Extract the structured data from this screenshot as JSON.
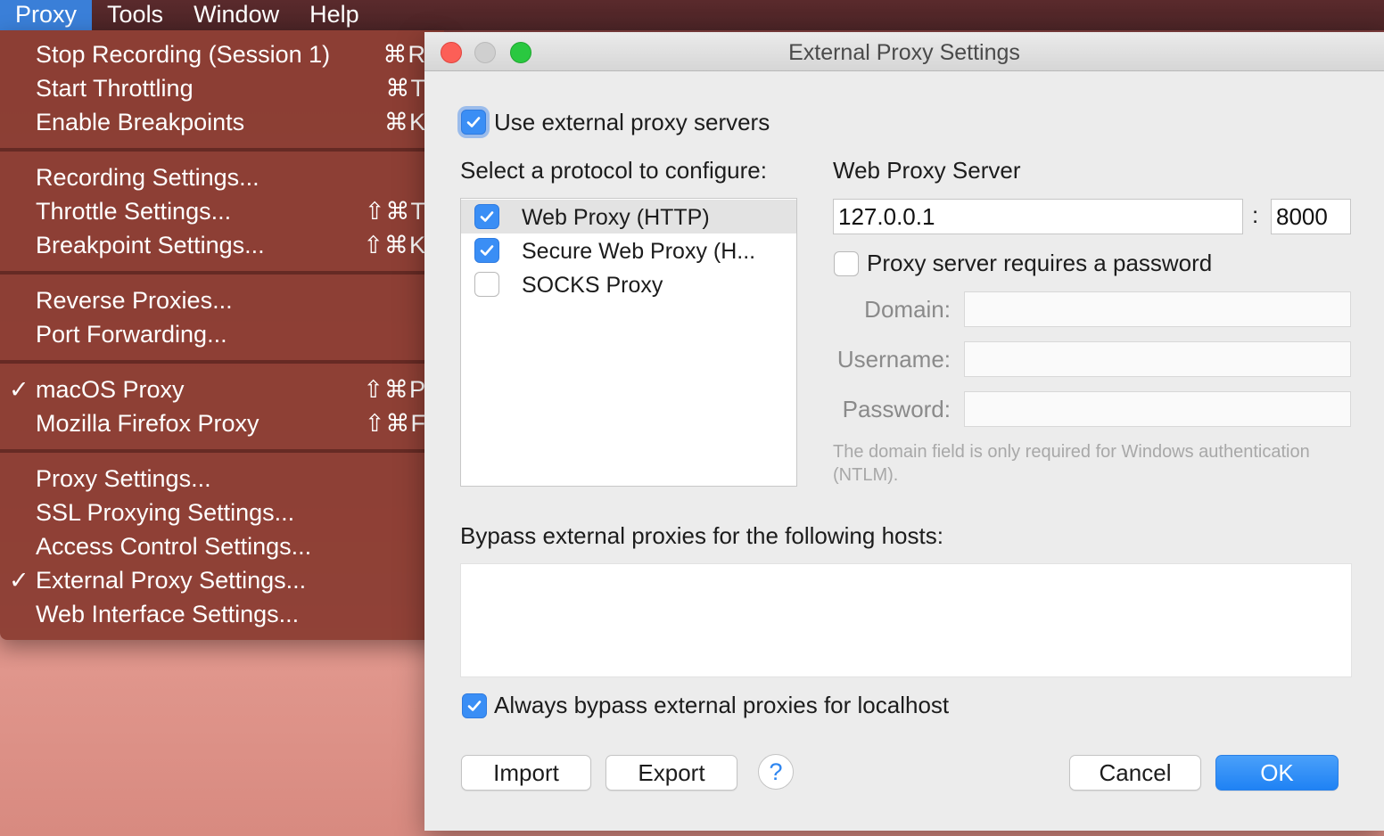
{
  "menubar": {
    "items": [
      {
        "label": "Proxy"
      },
      {
        "label": "Tools"
      },
      {
        "label": "Window"
      },
      {
        "label": "Help"
      }
    ]
  },
  "proxy_menu": {
    "groups": [
      [
        {
          "label": "Stop Recording (Session 1)",
          "shortcut": "⌘R",
          "checked": false
        },
        {
          "label": "Start Throttling",
          "shortcut": "⌘T",
          "checked": false
        },
        {
          "label": "Enable Breakpoints",
          "shortcut": "⌘K",
          "checked": false
        }
      ],
      [
        {
          "label": "Recording Settings...",
          "shortcut": "",
          "checked": false
        },
        {
          "label": "Throttle Settings...",
          "shortcut": "⇧⌘T",
          "checked": false
        },
        {
          "label": "Breakpoint Settings...",
          "shortcut": "⇧⌘K",
          "checked": false
        }
      ],
      [
        {
          "label": "Reverse Proxies...",
          "shortcut": "",
          "checked": false
        },
        {
          "label": "Port Forwarding...",
          "shortcut": "",
          "checked": false
        }
      ],
      [
        {
          "label": "macOS Proxy",
          "shortcut": "⇧⌘P",
          "checked": true
        },
        {
          "label": "Mozilla Firefox Proxy",
          "shortcut": "⇧⌘F",
          "checked": false
        }
      ],
      [
        {
          "label": "Proxy Settings...",
          "shortcut": "",
          "checked": false
        },
        {
          "label": "SSL Proxying Settings...",
          "shortcut": "",
          "checked": false
        },
        {
          "label": "Access Control Settings...",
          "shortcut": "",
          "checked": false
        },
        {
          "label": "External Proxy Settings...",
          "shortcut": "",
          "checked": true
        },
        {
          "label": "Web Interface Settings...",
          "shortcut": "",
          "checked": false
        }
      ]
    ],
    "check_glyph": "✓"
  },
  "dialog": {
    "title": "External Proxy Settings",
    "use_external": {
      "label": "Use external proxy servers",
      "checked": true
    },
    "protocol_heading": "Select a protocol to configure:",
    "protocols": [
      {
        "label": "Web Proxy (HTTP)",
        "checked": true,
        "selected": true
      },
      {
        "label": "Secure Web Proxy (H...",
        "checked": true,
        "selected": false
      },
      {
        "label": "SOCKS Proxy",
        "checked": false,
        "selected": false
      }
    ],
    "server_heading": "Web Proxy Server",
    "host_value": "127.0.0.1",
    "port_separator": ":",
    "port_value": "8000",
    "requires_password": {
      "label": "Proxy server requires a password",
      "checked": false
    },
    "domain_label": "Domain:",
    "username_label": "Username:",
    "password_label": "Password:",
    "note": "The domain field is only required for Windows authentication (NTLM).",
    "bypass_heading": "Bypass external proxies for the following hosts:",
    "always_bypass": {
      "label": "Always bypass external proxies for localhost",
      "checked": true
    },
    "buttons": {
      "import": "Import",
      "export": "Export",
      "help": "?",
      "cancel": "Cancel",
      "ok": "OK"
    }
  },
  "colors": {
    "accent": "#3a8ef5",
    "menu_bg": "#8c3e34",
    "close": "#fc5f57",
    "minimize": "#c9c9c9",
    "zoom": "#2ac840"
  }
}
